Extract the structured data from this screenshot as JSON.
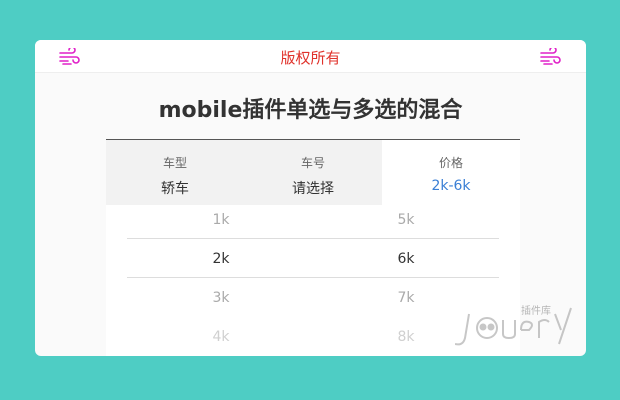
{
  "header": {
    "title": "版权所有"
  },
  "page": {
    "heading": "mobile插件单选与多选的混合"
  },
  "tabs": [
    {
      "label": "车型",
      "value": "轿车"
    },
    {
      "label": "车号",
      "value": "请选择"
    },
    {
      "label": "价格",
      "value": "2k-6k"
    }
  ],
  "picker": {
    "left_column": [
      "1k",
      "2k",
      "3k",
      "4k"
    ],
    "right_column": [
      "5k",
      "6k",
      "7k",
      "8k"
    ]
  },
  "watermark": {
    "text": "插件库"
  },
  "colors": {
    "background": "#4ecdc4",
    "title_red": "#e0322b",
    "accent_blue": "#3a7fd5",
    "icon_magenta": "#e020c8"
  },
  "icons": {
    "header_left": "wind-icon",
    "header_right": "wind-icon"
  }
}
